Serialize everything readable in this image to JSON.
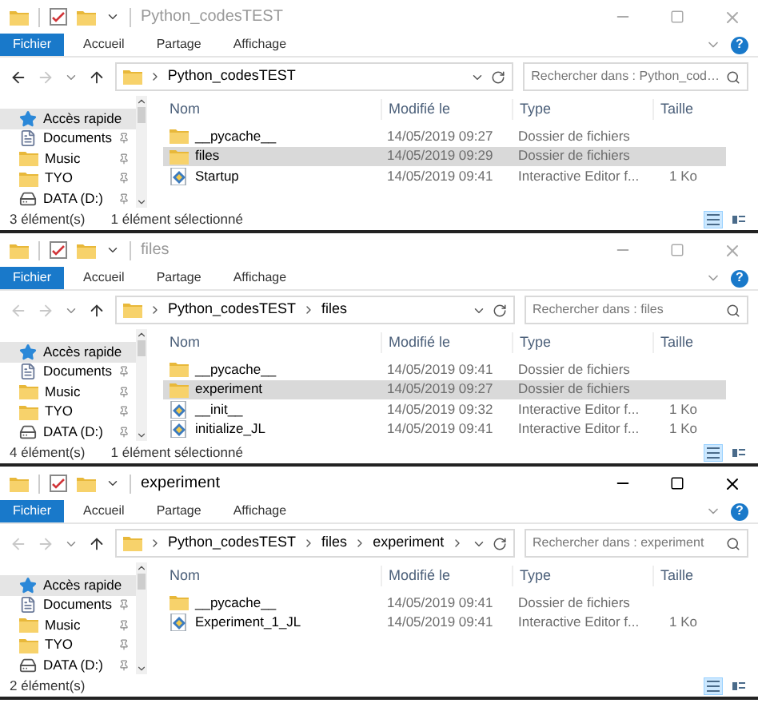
{
  "windows": [
    {
      "title": "Python_codesTEST",
      "active": false,
      "back_enabled": true,
      "ribbon_tabs": [
        {
          "label": "Fichier",
          "selected": true
        },
        {
          "label": "Accueil",
          "selected": false
        },
        {
          "label": "Partage",
          "selected": false
        },
        {
          "label": "Affichage",
          "selected": false
        }
      ],
      "help_label": "?",
      "breadcrumb": [
        "Python_codesTEST"
      ],
      "trailing_chevron": false,
      "search": {
        "placeholder": "Rechercher dans : Python_cod…"
      },
      "nav": [
        {
          "kind": "star",
          "label": "Accès rapide",
          "selected": true,
          "pinned": false
        },
        {
          "kind": "documents",
          "label": "Documents",
          "selected": false,
          "pinned": true
        },
        {
          "kind": "folder",
          "label": "Music",
          "selected": false,
          "pinned": true
        },
        {
          "kind": "folder",
          "label": "TYO",
          "selected": false,
          "pinned": true
        },
        {
          "kind": "drive",
          "label": "DATA (D:)",
          "selected": false,
          "pinned": true
        }
      ],
      "columns": [
        "Nom",
        "Modifié le",
        "Type",
        "Taille"
      ],
      "rows": [
        {
          "kind": "folder",
          "name": "__pycache__",
          "modified": "14/05/2019 09:27",
          "type": "Dossier de fichiers",
          "selected": false
        },
        {
          "kind": "folder",
          "name": "files",
          "modified": "14/05/2019 09:29",
          "type": "Dossier de fichiers",
          "selected": true
        },
        {
          "kind": "python",
          "name": "Startup",
          "modified": "14/05/2019 09:41",
          "type": "Interactive Editor f...",
          "size": "1 Ko",
          "selected": false
        }
      ],
      "status": {
        "count": "3 élément(s)",
        "selection": "1 élément sélectionné"
      },
      "views": [
        {
          "kind": "details",
          "selected": true
        },
        {
          "kind": "tiles",
          "selected": false
        }
      ]
    },
    {
      "title": "files",
      "active": false,
      "back_enabled": false,
      "ribbon_tabs": [
        {
          "label": "Fichier",
          "selected": true
        },
        {
          "label": "Accueil",
          "selected": false
        },
        {
          "label": "Partage",
          "selected": false
        },
        {
          "label": "Affichage",
          "selected": false
        }
      ],
      "help_label": "?",
      "breadcrumb": [
        "Python_codesTEST",
        "files"
      ],
      "trailing_chevron": false,
      "search": {
        "placeholder": "Rechercher dans : files"
      },
      "nav": [
        {
          "kind": "star",
          "label": "Accès rapide",
          "selected": true,
          "pinned": false
        },
        {
          "kind": "documents",
          "label": "Documents",
          "selected": false,
          "pinned": true
        },
        {
          "kind": "folder",
          "label": "Music",
          "selected": false,
          "pinned": true
        },
        {
          "kind": "folder",
          "label": "TYO",
          "selected": false,
          "pinned": true
        },
        {
          "kind": "drive",
          "label": "DATA (D:)",
          "selected": false,
          "pinned": true
        }
      ],
      "columns": [
        "Nom",
        "Modifié le",
        "Type",
        "Taille"
      ],
      "rows": [
        {
          "kind": "folder",
          "name": "__pycache__",
          "modified": "14/05/2019 09:41",
          "type": "Dossier de fichiers",
          "selected": false
        },
        {
          "kind": "folder",
          "name": "experiment",
          "modified": "14/05/2019 09:27",
          "type": "Dossier de fichiers",
          "selected": true
        },
        {
          "kind": "python",
          "name": "__init__",
          "modified": "14/05/2019 09:32",
          "type": "Interactive Editor f...",
          "size": "1 Ko",
          "selected": false
        },
        {
          "kind": "python",
          "name": "initialize_JL",
          "modified": "14/05/2019 09:41",
          "type": "Interactive Editor f...",
          "size": "1 Ko",
          "selected": false
        }
      ],
      "status": {
        "count": "4 élément(s)",
        "selection": "1 élément sélectionné"
      },
      "views": [
        {
          "kind": "details",
          "selected": true
        },
        {
          "kind": "tiles",
          "selected": false
        }
      ]
    },
    {
      "title": "experiment",
      "active": true,
      "back_enabled": false,
      "ribbon_tabs": [
        {
          "label": "Fichier",
          "selected": true
        },
        {
          "label": "Accueil",
          "selected": false
        },
        {
          "label": "Partage",
          "selected": false
        },
        {
          "label": "Affichage",
          "selected": false
        }
      ],
      "help_label": "?",
      "breadcrumb": [
        "Python_codesTEST",
        "files",
        "experiment"
      ],
      "trailing_chevron": true,
      "search": {
        "placeholder": "Rechercher dans : experiment"
      },
      "nav": [
        {
          "kind": "star",
          "label": "Accès rapide",
          "selected": true,
          "pinned": false
        },
        {
          "kind": "documents",
          "label": "Documents",
          "selected": false,
          "pinned": true
        },
        {
          "kind": "folder",
          "label": "Music",
          "selected": false,
          "pinned": true
        },
        {
          "kind": "folder",
          "label": "TYO",
          "selected": false,
          "pinned": true
        },
        {
          "kind": "drive",
          "label": "DATA (D:)",
          "selected": false,
          "pinned": true
        }
      ],
      "columns": [
        "Nom",
        "Modifié le",
        "Type",
        "Taille"
      ],
      "rows": [
        {
          "kind": "folder",
          "name": "__pycache__",
          "modified": "14/05/2019 09:41",
          "type": "Dossier de fichiers",
          "selected": false
        },
        {
          "kind": "python",
          "name": "Experiment_1_JL",
          "modified": "14/05/2019 09:41",
          "type": "Interactive Editor f...",
          "size": "1 Ko",
          "selected": false
        }
      ],
      "status": {
        "count": "2 élément(s)"
      },
      "views": [
        {
          "kind": "details",
          "selected": true
        },
        {
          "kind": "tiles",
          "selected": false
        }
      ]
    }
  ]
}
